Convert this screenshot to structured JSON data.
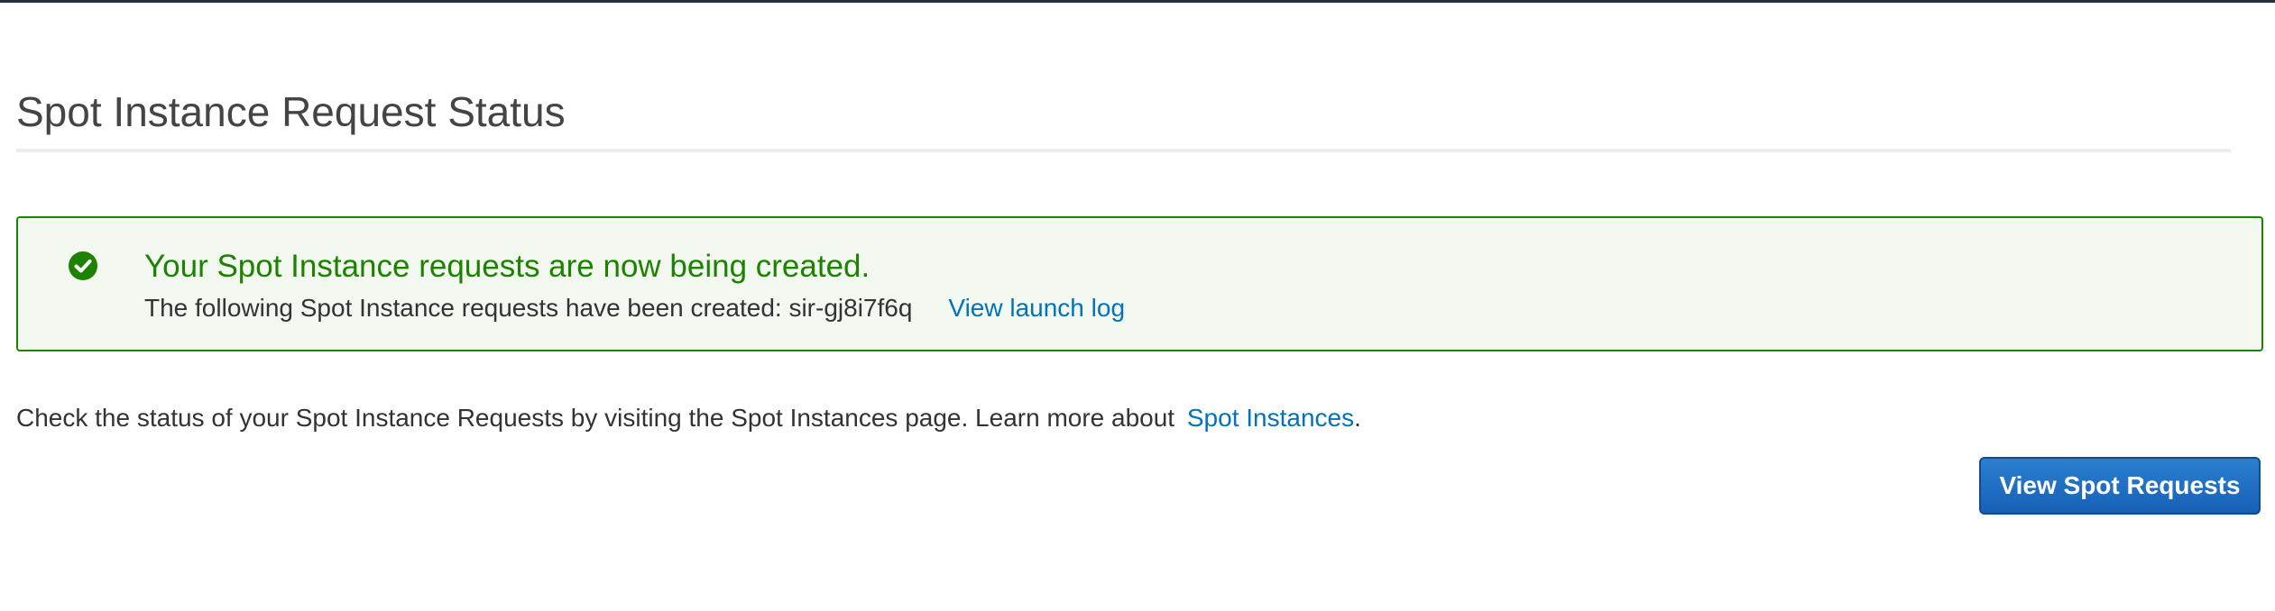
{
  "page": {
    "title": "Spot Instance Request Status"
  },
  "alert": {
    "status": "success",
    "icon": "check-circle-icon",
    "color": "#1d8102",
    "title": "Your Spot Instance requests are now being created.",
    "body_prefix": "The following Spot Instance requests have been created: ",
    "request_id": "sir-gj8i7f6q",
    "launch_log_link": "View launch log"
  },
  "info": {
    "text": "Check the status of your Spot Instance Requests by visiting the Spot Instances page. Learn more about ",
    "link": "Spot Instances",
    "suffix": "."
  },
  "actions": {
    "view_requests_label": "View Spot Requests",
    "accent_color": "#1660b6"
  }
}
